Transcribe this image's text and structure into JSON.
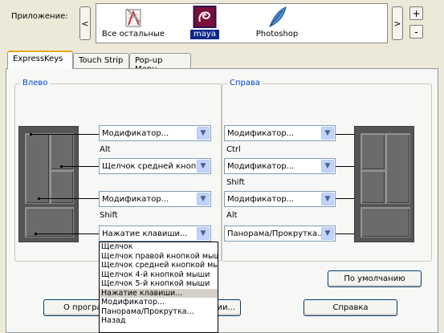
{
  "app_selector": {
    "label": "Приложение:",
    "prev_icon": "chevron-left-icon",
    "next_icon": "chevron-right-icon",
    "add_label": "+",
    "remove_label": "-",
    "apps": [
      {
        "name": "Все остальные",
        "icon": "all-apps-icon",
        "selected": false
      },
      {
        "name": "maya",
        "icon": "maya-icon",
        "selected": true
      },
      {
        "name": "Photoshop",
        "icon": "photoshop-feather-icon",
        "selected": false
      }
    ]
  },
  "tabs": [
    {
      "label": "ExpressKeys",
      "active": true
    },
    {
      "label": "Touch Strip",
      "active": false
    },
    {
      "label": "Pop-up Menu",
      "active": false
    }
  ],
  "left_group": {
    "title": "Влево",
    "keys": [
      {
        "value": "Модификатор...",
        "modifier": "Alt"
      },
      {
        "value": "Щелчок средней кнопкой",
        "modifier": ""
      },
      {
        "value": "Модификатор...",
        "modifier": "Shift"
      },
      {
        "value": "Нажатие клавиши...",
        "modifier": ""
      }
    ]
  },
  "right_group": {
    "title": "Справа",
    "keys": [
      {
        "value": "Модификатор...",
        "modifier": "Ctrl"
      },
      {
        "value": "Модификатор...",
        "modifier": "Shift"
      },
      {
        "value": "Модификатор...",
        "modifier": "Alt"
      },
      {
        "value": "Панорама/Прокрутка...",
        "modifier": ""
      }
    ]
  },
  "default_button": "По умолчанию",
  "bottom_buttons": {
    "about_left": "О програм",
    "about_right": "ии...",
    "help": "Справка"
  },
  "dropdown": {
    "options": [
      "Щелчок",
      "Щелчок правой кнопкой мыши",
      "Щелчок средней кнопкой мыши",
      "Щелчок 4-й кнопкой мыши",
      "Щелчок 5-й кнопкой мыши",
      "Нажатие клавиши...",
      "Модификатор...",
      "Панорама/Прокрутка...",
      "Назад"
    ],
    "highlighted_index": 5
  },
  "colors": {
    "selected_app_bg": "#0b2a8a",
    "group_title": "#0046d5",
    "tab_accent": "#e6a700"
  }
}
